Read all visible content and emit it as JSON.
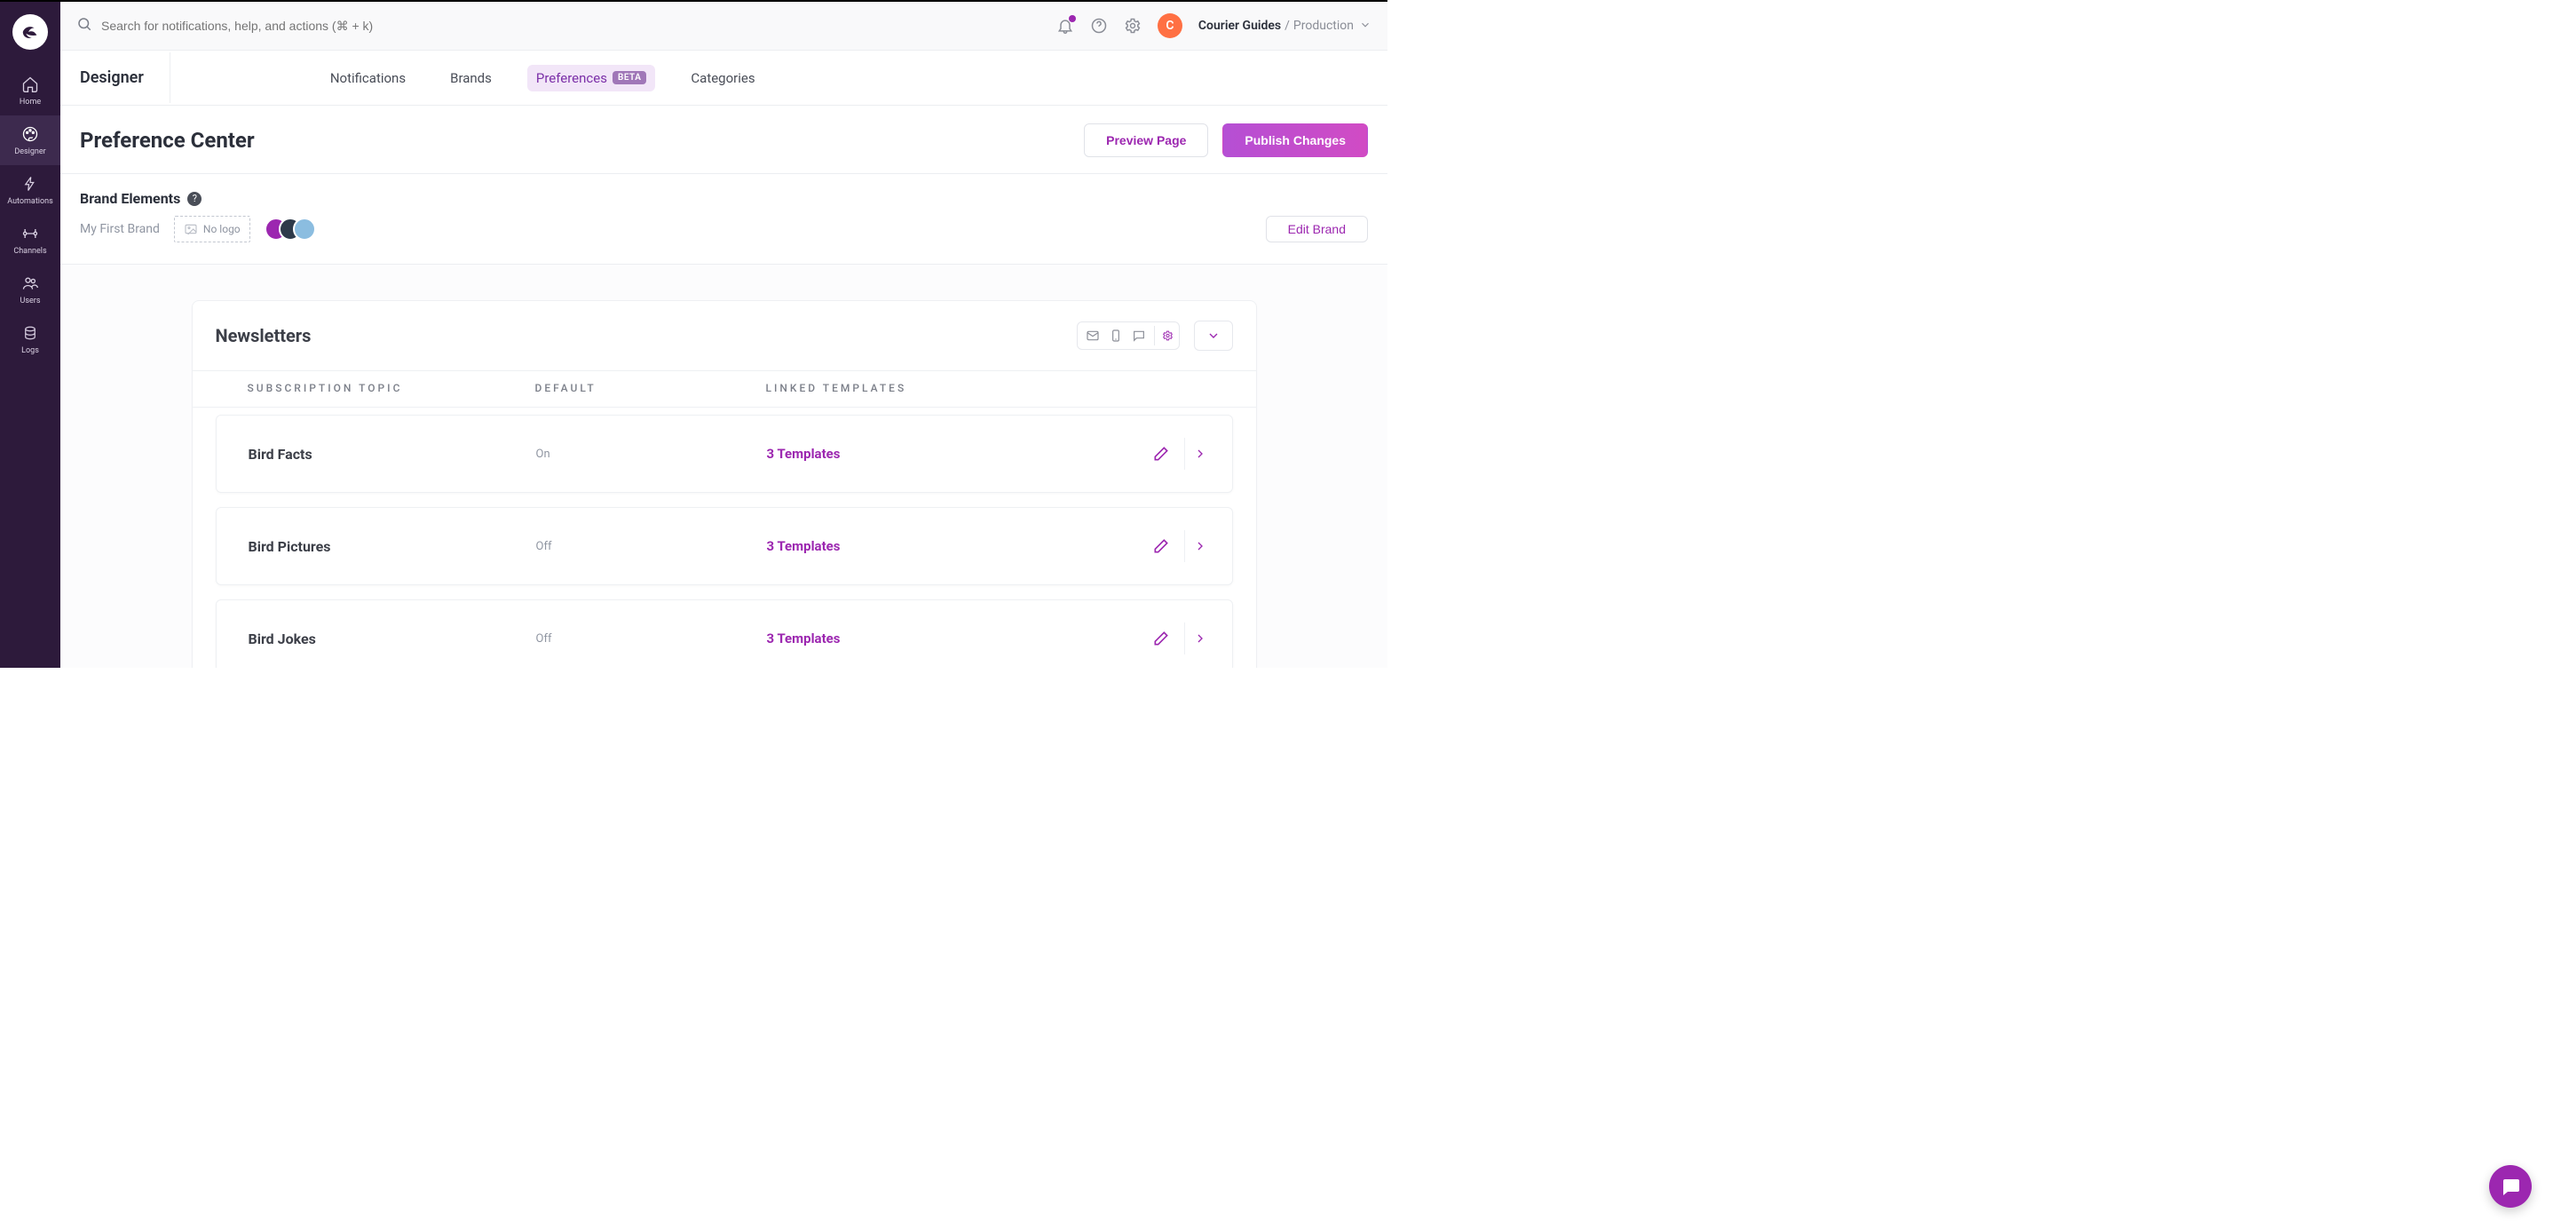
{
  "topbar": {
    "search_placeholder": "Search for notifications, help, and actions (⌘ + k)",
    "avatar_initial": "C",
    "org": "Courier Guides",
    "sep": " / ",
    "env": "Production"
  },
  "sidebar": {
    "items": [
      {
        "label": "Home"
      },
      {
        "label": "Designer"
      },
      {
        "label": "Automations"
      },
      {
        "label": "Channels"
      },
      {
        "label": "Users"
      },
      {
        "label": "Logs"
      }
    ]
  },
  "designerNav": {
    "title": "Designer",
    "tabs": [
      {
        "label": "Notifications"
      },
      {
        "label": "Brands"
      },
      {
        "label": "Preferences",
        "badge": "BETA",
        "active": true
      },
      {
        "label": "Categories"
      }
    ]
  },
  "page": {
    "title": "Preference Center",
    "preview": "Preview Page",
    "publish": "Publish Changes"
  },
  "brand": {
    "heading": "Brand Elements",
    "name": "My First Brand",
    "no_logo": "No logo",
    "colors": [
      "#9c27b0",
      "#2e3a4a",
      "#8bbde0"
    ],
    "edit": "Edit Brand"
  },
  "section": {
    "name": "Newsletters",
    "columns": {
      "topic": "SUBSCRIPTION TOPIC",
      "default": "DEFAULT",
      "linked": "LINKED TEMPLATES"
    },
    "rows": [
      {
        "topic": "Bird Facts",
        "default": "On",
        "linked": "3 Templates"
      },
      {
        "topic": "Bird Pictures",
        "default": "Off",
        "linked": "3 Templates"
      },
      {
        "topic": "Bird Jokes",
        "default": "Off",
        "linked": "3 Templates"
      }
    ]
  }
}
